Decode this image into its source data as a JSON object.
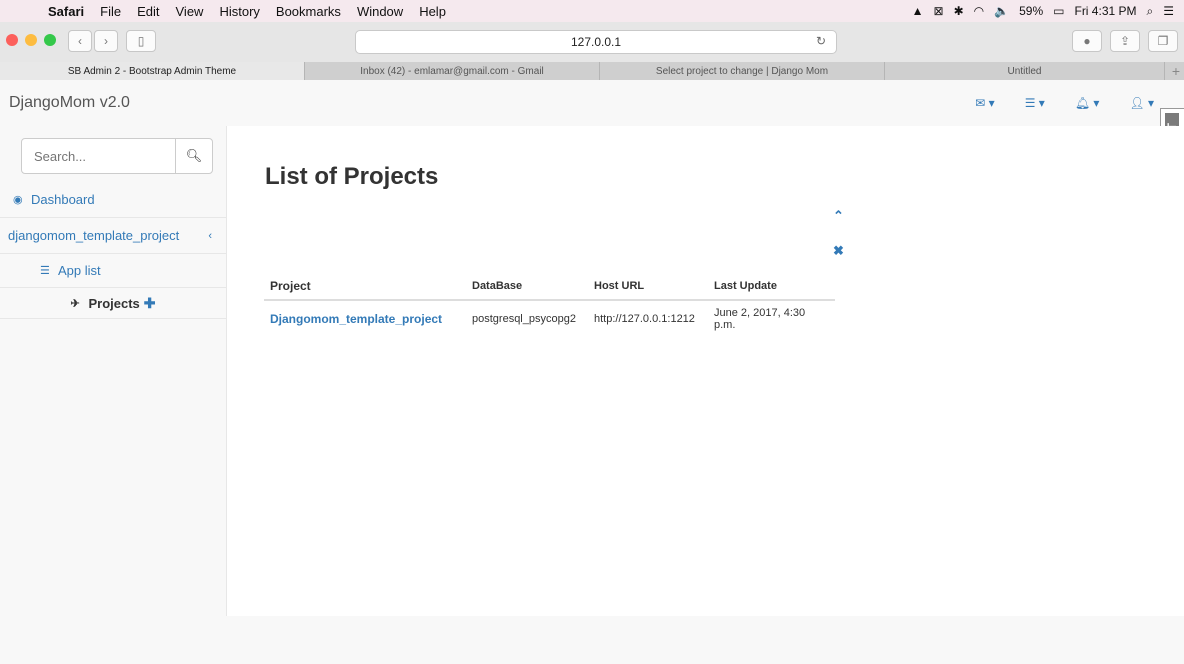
{
  "menubar": {
    "items": [
      "Safari",
      "File",
      "Edit",
      "View",
      "History",
      "Bookmarks",
      "Window",
      "Help"
    ],
    "battery": "59%",
    "clock": "Fri 4:31 PM"
  },
  "browser": {
    "url": "127.0.0.1",
    "tabs": [
      {
        "label": "SB Admin 2 - Bootstrap Admin Theme",
        "active": true
      },
      {
        "label": "Inbox (42) - emlamar@gmail.com - Gmail",
        "active": false
      },
      {
        "label": "Select project to change | Django Mom",
        "active": false
      },
      {
        "label": "Untitled",
        "active": false
      }
    ]
  },
  "app": {
    "brand": "DjangoMom v2.0",
    "search_placeholder": "Search...",
    "sidebar": {
      "dashboard": "Dashboard",
      "project": "djangomom_template_project",
      "app_list": "App list",
      "projects": "Projects"
    },
    "page_title": "List of Projects",
    "table": {
      "headers": [
        "Project",
        "DataBase",
        "Host URL",
        "Last Update"
      ],
      "rows": [
        {
          "project": "Djangomom_template_project",
          "database": "postgresql_psycopg2",
          "host": "http://127.0.0.1:1212",
          "updated": "June 2, 2017, 4:30 p.m."
        }
      ]
    }
  },
  "colors": {
    "link": "#337ab7",
    "menubar_bg": "#f5e9ee"
  }
}
